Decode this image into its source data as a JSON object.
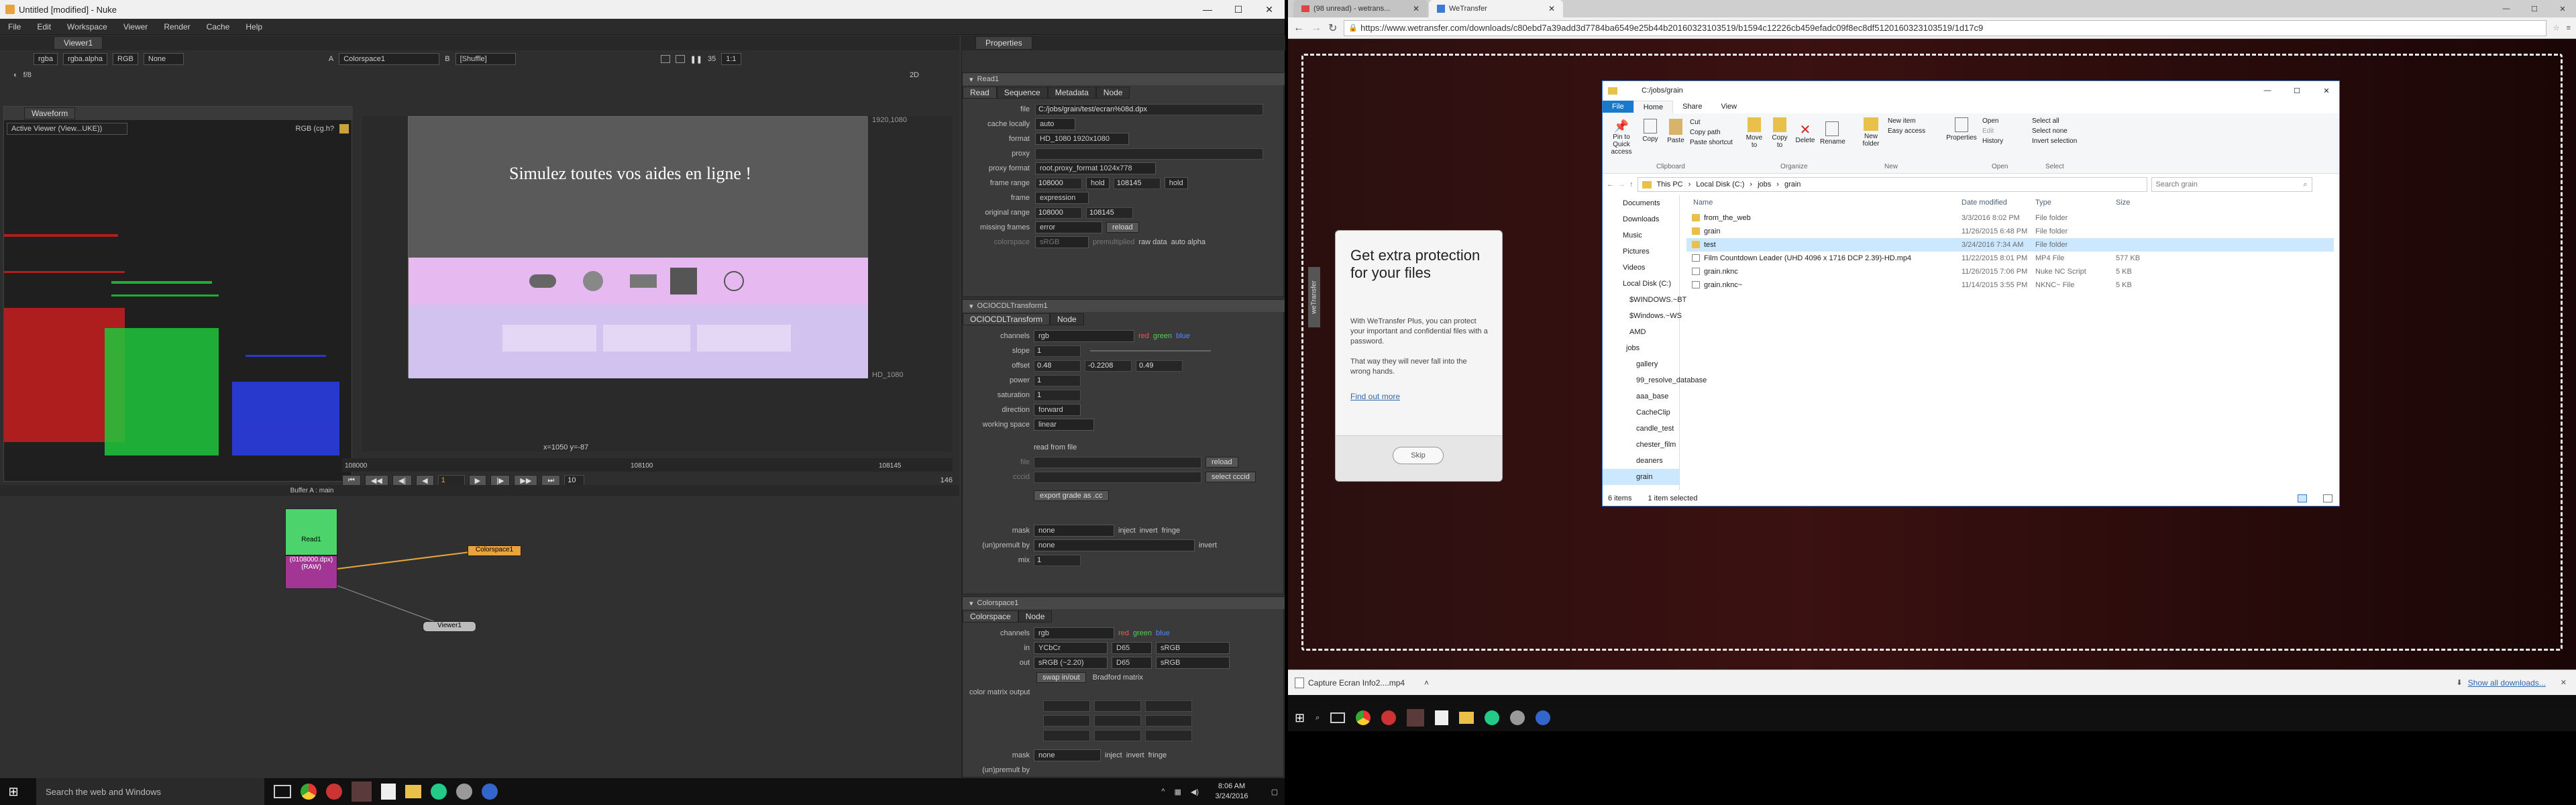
{
  "nuke": {
    "title": "Untitled [modified] - Nuke",
    "menu": [
      "File",
      "Edit",
      "Workspace",
      "Viewer",
      "Render",
      "Cache",
      "Help"
    ],
    "viewer_tab": "Viewer1",
    "properties_tab": "Properties",
    "viewer_toolbar": {
      "channels": "rgba",
      "alpha": "rgba.alpha",
      "rgb": "RGB",
      "none": "None",
      "a_label": "A",
      "colorspace": "Colorspace1",
      "b_label": "B",
      "b_input": "[Shuffle]",
      "zoom": "1:1",
      "mode": "2D",
      "fstop": "f/8",
      "gain_val": "1",
      "gamma_val": "1",
      "frame": "35"
    },
    "waveform": {
      "tab": "Waveform",
      "viewer": "Active Viewer (View...UKE))",
      "colorspace": "RGB (cg.h?"
    },
    "viewer": {
      "res_label": "1920,1080",
      "hd_label": "HD_1080",
      "coords": "x=1050 y=-87",
      "web_title": "Simulez toutes vos aides en ligne !",
      "frame_start": "108000",
      "frame_mid": "108100",
      "frame_end": "108145",
      "cur_frame": "1",
      "fps_val": "10",
      "step": "146",
      "buffer": "Buffer A : main"
    },
    "nodes": {
      "read": "Read1",
      "read_sub": "(0108000.dpx)\n(RAW)",
      "colorspace": "Colorspace1",
      "viewer": "Viewer1"
    },
    "read1": {
      "name": "Read1",
      "tabs": [
        "Read",
        "Sequence",
        "Metadata",
        "Node"
      ],
      "rows": [
        {
          "label": "file",
          "value": "C:/jobs/grain/test/ecran%08d.dpx"
        },
        {
          "label": "cache locally",
          "value": "auto"
        },
        {
          "label": "format",
          "value": "HD_1080 1920x1080"
        },
        {
          "label": "proxy",
          "value": ""
        },
        {
          "label": "proxy format",
          "value": "root.proxy_format 1024x778"
        },
        {
          "label": "frame range",
          "value": "108000",
          "value2": "108145",
          "hold1": "hold",
          "hold2": "hold"
        },
        {
          "label": "frame",
          "value": "expression"
        },
        {
          "label": "original range",
          "value": "108000",
          "value2": "108145"
        },
        {
          "label": "missing frames",
          "value": "error",
          "extra": "reload"
        },
        {
          "label": "colorspace",
          "value": "sRGB",
          "premult": "premultiplied",
          "raw": "raw data",
          "auto": "auto alpha"
        }
      ]
    },
    "ocio": {
      "name": "OCIOCDLTransform1",
      "tabs": [
        "OCIOCDLTransform",
        "Node"
      ],
      "channels": "rgb",
      "red": "red",
      "green": "green",
      "blue": "blue",
      "slope": "1",
      "offset": [
        "0.48",
        "-0.2208",
        "0.49"
      ],
      "power": "1",
      "saturation": "1",
      "direction": "forward",
      "working_space": "linear",
      "read_file": "read from file",
      "file_label": "file",
      "reload": "reload",
      "cccid": "cccid",
      "select_cccid": "select cccid",
      "export": "export grade as .cc",
      "mask": "none",
      "inject": "inject",
      "invert": "invert",
      "fringe": "fringe",
      "unpremult_label": "(un)premult by",
      "unpremult": "none",
      "invert2": "invert",
      "mix": "1",
      "labels": {
        "channels": "channels",
        "slope": "slope",
        "offset": "offset",
        "power": "power",
        "saturation": "saturation",
        "direction": "direction",
        "working_space": "working space",
        "mask": "mask",
        "mix": "mix"
      }
    },
    "colorspace": {
      "name": "Colorspace1",
      "tabs": [
        "Colorspace",
        "Node"
      ],
      "channels": "rgb",
      "red": "red",
      "green": "green",
      "blue": "blue",
      "in_label": "in",
      "in": "YCbCr",
      "in_wp": "D65",
      "in_prim": "sRGB",
      "out_label": "out",
      "out": "sRGB (~2.20)",
      "out_wp": "D65",
      "out_prim": "sRGB",
      "swap": "swap in/out",
      "bradford": "Bradford matrix",
      "matrix_label": "color matrix output",
      "mask_label": "mask",
      "mask": "none",
      "inject": "inject",
      "invert": "invert",
      "fringe": "fringe",
      "unpremult_label": "(un)premult by"
    }
  },
  "chrome": {
    "tabs": [
      {
        "label": "(98 unread) - wetrans..."
      },
      {
        "label": "WeTransfer"
      }
    ],
    "url": "https://www.wetransfer.com/downloads/c80ebd7a39add3d7784ba6549e25b44b20160323103519/b1594c12226cb459efadc09f8ec8df5120160323103519/1d17c9",
    "wt_tab_label": "weTransfer",
    "card": {
      "title": "Get extra protection for your files",
      "p1": "With WeTransfer Plus, you can protect your important and confidential files with a password.",
      "p2": "That way they will never fall into the wrong hands.",
      "link": "Find out more",
      "skip": "Skip"
    },
    "download": {
      "file": "Capture Ecran Info2....mp4",
      "show_all": "Show all downloads..."
    }
  },
  "explorer": {
    "title": "C:/jobs/grain",
    "ribbon_tabs": [
      "File",
      "Home",
      "Share",
      "View"
    ],
    "ribbon": {
      "clipboard": [
        "Pin to Quick access",
        "Copy",
        "Paste"
      ],
      "clip_small": [
        "Cut",
        "Copy path",
        "Paste shortcut"
      ],
      "organize": [
        "Move to",
        "Copy to",
        "Delete",
        "Rename"
      ],
      "new": [
        "New folder"
      ],
      "new_small": [
        "New item",
        "Easy access"
      ],
      "open": [
        "Properties"
      ],
      "open_small": [
        "Open",
        "Edit",
        "History"
      ],
      "select_small": [
        "Select all",
        "Select none",
        "Invert selection"
      ],
      "groups": [
        "Clipboard",
        "Organize",
        "New",
        "Open",
        "Select"
      ]
    },
    "path": [
      "This PC",
      "Local Disk (C:)",
      "jobs",
      "grain"
    ],
    "search": "Search grain",
    "columns": [
      "Name",
      "Date modified",
      "Type",
      "Size"
    ],
    "files": [
      {
        "name": "from_the_web",
        "date": "3/3/2016 8:02 PM",
        "type": "File folder",
        "size": ""
      },
      {
        "name": "grain",
        "date": "11/26/2015 6:48 PM",
        "type": "File folder",
        "size": ""
      },
      {
        "name": "test",
        "date": "3/24/2016 7:34 AM",
        "type": "File folder",
        "size": ""
      },
      {
        "name": "Film Countdown Leader (UHD 4096 x 1716 DCP 2.39)-HD.mp4",
        "date": "11/22/2015 8:01 PM",
        "type": "MP4 File",
        "size": "577 KB"
      },
      {
        "name": "grain.nknc",
        "date": "11/26/2015 7:06 PM",
        "type": "Nuke NC Script",
        "size": "5 KB"
      },
      {
        "name": "grain.nknc~",
        "date": "11/14/2015 3:55 PM",
        "type": "NKNC~ File",
        "size": "5 KB"
      }
    ],
    "tree": [
      "Documents",
      "Downloads",
      "Music",
      "Pictures",
      "Videos",
      "Local Disk (C:)",
      "$WINDOWS.~BT",
      "$Windows.~WS",
      "AMD",
      "jobs",
      "gallery",
      "99_resolve_database",
      "aaa_base",
      "CacheClip",
      "candle_test",
      "chester_film",
      "deaners",
      "grain"
    ],
    "status": [
      "6 items",
      "1 item selected"
    ]
  },
  "taskbar": {
    "search": "Search the web and Windows",
    "time": "8:06 AM",
    "date": "3/24/2016"
  }
}
